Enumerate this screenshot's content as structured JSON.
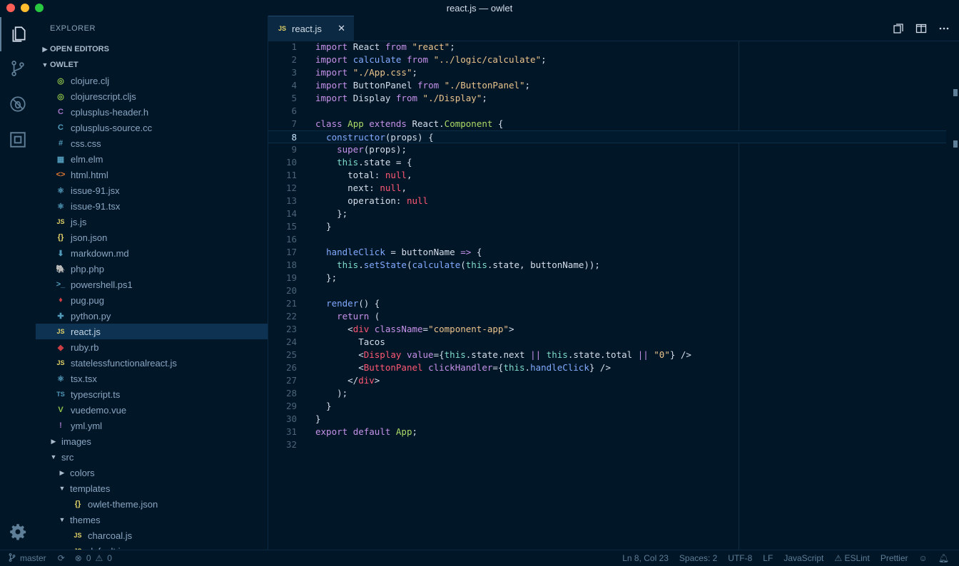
{
  "window": {
    "title": "react.js — owlet"
  },
  "sidebar": {
    "title": "EXPLORER",
    "open_editors": "OPEN EDITORS",
    "folder": "OWLET",
    "files": [
      {
        "name": "clojure.clj",
        "icon": "clojure-icon",
        "glyph": "◎",
        "color": "#8dc149"
      },
      {
        "name": "clojurescript.cljs",
        "icon": "clojurescript-icon",
        "glyph": "◎",
        "color": "#8dc149"
      },
      {
        "name": "cplusplus-header.h",
        "icon": "c-icon",
        "glyph": "C",
        "color": "#a074c4"
      },
      {
        "name": "cplusplus-source.cc",
        "icon": "cpp-icon",
        "glyph": "C",
        "color": "#519aba"
      },
      {
        "name": "css.css",
        "icon": "css-icon",
        "glyph": "#",
        "color": "#519aba"
      },
      {
        "name": "elm.elm",
        "icon": "elm-icon",
        "glyph": "▦",
        "color": "#519aba"
      },
      {
        "name": "html.html",
        "icon": "html-icon",
        "glyph": "<>",
        "color": "#e37933"
      },
      {
        "name": "issue-91.jsx",
        "icon": "react-icon",
        "glyph": "⚛",
        "color": "#519aba"
      },
      {
        "name": "issue-91.tsx",
        "icon": "react-icon",
        "glyph": "⚛",
        "color": "#519aba"
      },
      {
        "name": "js.js",
        "icon": "javascript-icon",
        "glyph": "JS",
        "color": "#e2d267"
      },
      {
        "name": "json.json",
        "icon": "json-icon",
        "glyph": "{}",
        "color": "#e2d267"
      },
      {
        "name": "markdown.md",
        "icon": "markdown-icon",
        "glyph": "⬇",
        "color": "#519aba"
      },
      {
        "name": "php.php",
        "icon": "php-icon",
        "glyph": "🐘",
        "color": "#a074c4"
      },
      {
        "name": "powershell.ps1",
        "icon": "powershell-icon",
        "glyph": ">_",
        "color": "#519aba"
      },
      {
        "name": "pug.pug",
        "icon": "pug-icon",
        "glyph": "♦",
        "color": "#cc3e44"
      },
      {
        "name": "python.py",
        "icon": "python-icon",
        "glyph": "✚",
        "color": "#519aba"
      },
      {
        "name": "react.js",
        "icon": "javascript-icon",
        "glyph": "JS",
        "color": "#e2d267",
        "selected": true
      },
      {
        "name": "ruby.rb",
        "icon": "ruby-icon",
        "glyph": "◆",
        "color": "#cc3e44"
      },
      {
        "name": "statelessfunctionalreact.js",
        "icon": "javascript-icon",
        "glyph": "JS",
        "color": "#e2d267"
      },
      {
        "name": "tsx.tsx",
        "icon": "react-icon",
        "glyph": "⚛",
        "color": "#519aba"
      },
      {
        "name": "typescript.ts",
        "icon": "typescript-icon",
        "glyph": "TS",
        "color": "#519aba"
      },
      {
        "name": "vuedemo.vue",
        "icon": "vue-icon",
        "glyph": "V",
        "color": "#8dc149"
      },
      {
        "name": "yml.yml",
        "icon": "yaml-icon",
        "glyph": "!",
        "color": "#a074c4"
      }
    ],
    "folders": [
      {
        "name": "images",
        "depth": 1,
        "open": false
      },
      {
        "name": "src",
        "depth": 1,
        "open": true
      },
      {
        "name": "colors",
        "depth": 2,
        "open": false
      },
      {
        "name": "templates",
        "depth": 2,
        "open": true
      },
      {
        "name": "owlet-theme.json",
        "depth": 3,
        "file": true,
        "glyph": "{}",
        "color": "#e2d267"
      },
      {
        "name": "themes",
        "depth": 2,
        "open": true
      },
      {
        "name": "charcoal.js",
        "depth": 3,
        "file": true,
        "glyph": "JS",
        "color": "#e2d267"
      },
      {
        "name": "default.js",
        "depth": 3,
        "file": true,
        "glyph": "JS",
        "color": "#e2d267"
      }
    ]
  },
  "editor": {
    "tab_label": "react.js",
    "tab_icon_text": "JS",
    "close_glyph": "✕",
    "current_line": 8
  },
  "code": [
    "import React from \"react\";",
    "import calculate from \"../logic/calculate\";",
    "import \"./App.css\";",
    "import ButtonPanel from \"./ButtonPanel\";",
    "import Display from \"./Display\";",
    "",
    "class App extends React.Component {",
    "  constructor(props) {",
    "    super(props);",
    "    this.state = {",
    "      total: null,",
    "      next: null,",
    "      operation: null",
    "    };",
    "  }",
    "",
    "  handleClick = buttonName => {",
    "    this.setState(calculate(this.state, buttonName));",
    "  };",
    "",
    "  render() {",
    "    return (",
    "      <div className=\"component-app\">",
    "        Tacos",
    "        <Display value={this.state.next || this.state.total || \"0\"} />",
    "        <ButtonPanel clickHandler={this.handleClick} />",
    "      </div>",
    "    );",
    "  }",
    "}",
    "export default App;",
    ""
  ],
  "status": {
    "branch": "master",
    "errors": "0",
    "warnings": "0",
    "position": "Ln 8, Col 23",
    "spaces": "Spaces: 2",
    "encoding": "UTF-8",
    "eol": "LF",
    "language": "JavaScript",
    "eslint": "ESLint",
    "prettier": "Prettier"
  },
  "colors": {
    "background": "#011627",
    "selection": "#0e3352",
    "keyword": "#c792ea",
    "string": "#ecc48d",
    "null": "#ff5874",
    "function": "#82aaff",
    "class": "#addb67"
  }
}
